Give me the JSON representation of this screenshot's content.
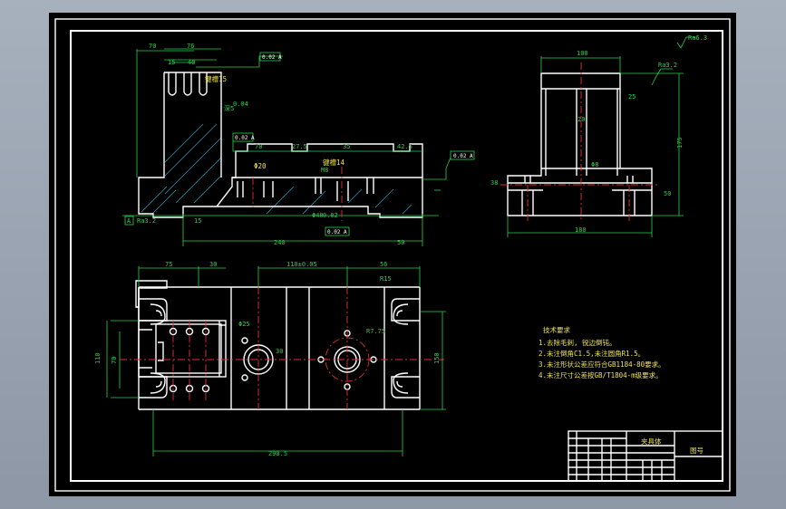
{
  "drawing": {
    "front_view": {
      "dims_top": [
        "70",
        "76",
        "15",
        "40"
      ],
      "dim_width_15": "键槽15",
      "dim_depth": "深5",
      "tol_a": "0.04",
      "frame_ref_top": "0.02 A",
      "frame_ref_mid": "0.02 A",
      "frame_ref_right": "0.02 A",
      "frame_ref_bottom": "0.02 A",
      "dims_mid": [
        "70",
        "27.5",
        "35",
        "42.5"
      ],
      "dim_m8": "M8",
      "dim_slot14": "键槽14",
      "dim_phi20": "Φ20",
      "dim_phi40": "Φ40",
      "dim_tol": "0.02",
      "dim_15": "15",
      "dim_240": "240",
      "dim_50": "50",
      "ra_small": "Ra3.2",
      "datum": "A"
    },
    "side_view": {
      "dim_top": "100",
      "dim_height": "175",
      "dim_20": "20",
      "dim_50": "50",
      "dim_bottom": "180",
      "dim_38": "38",
      "dim_25": "25",
      "dim_phi": "Φ8",
      "ra": "Ra3.2"
    },
    "plan_view": {
      "dim_75": "75",
      "dim_30": "30",
      "dim_center": "110±0.05",
      "dim_56": "56",
      "dim_r15": "R15",
      "dim_r775": "R7.75",
      "dim_110": "110",
      "dim_70": "70",
      "dim_30b": "30",
      "dim_phi25": "Φ25",
      "dim_150": "150",
      "dim_290": "290.5"
    },
    "notes": {
      "title": "技术要求",
      "lines": [
        "1.去除毛刺, 锐边倒钝。",
        "2.未注倒角C1.5,未注圆角R1.5。",
        "3.未注形状公差应符合GB1184-80要求。",
        "4.未注尺寸公差按GB/T1804-m级要求。"
      ]
    },
    "title_block": {
      "part_name": "夹具体",
      "code": "图号"
    },
    "surface_top_right": "Ra6.3"
  }
}
